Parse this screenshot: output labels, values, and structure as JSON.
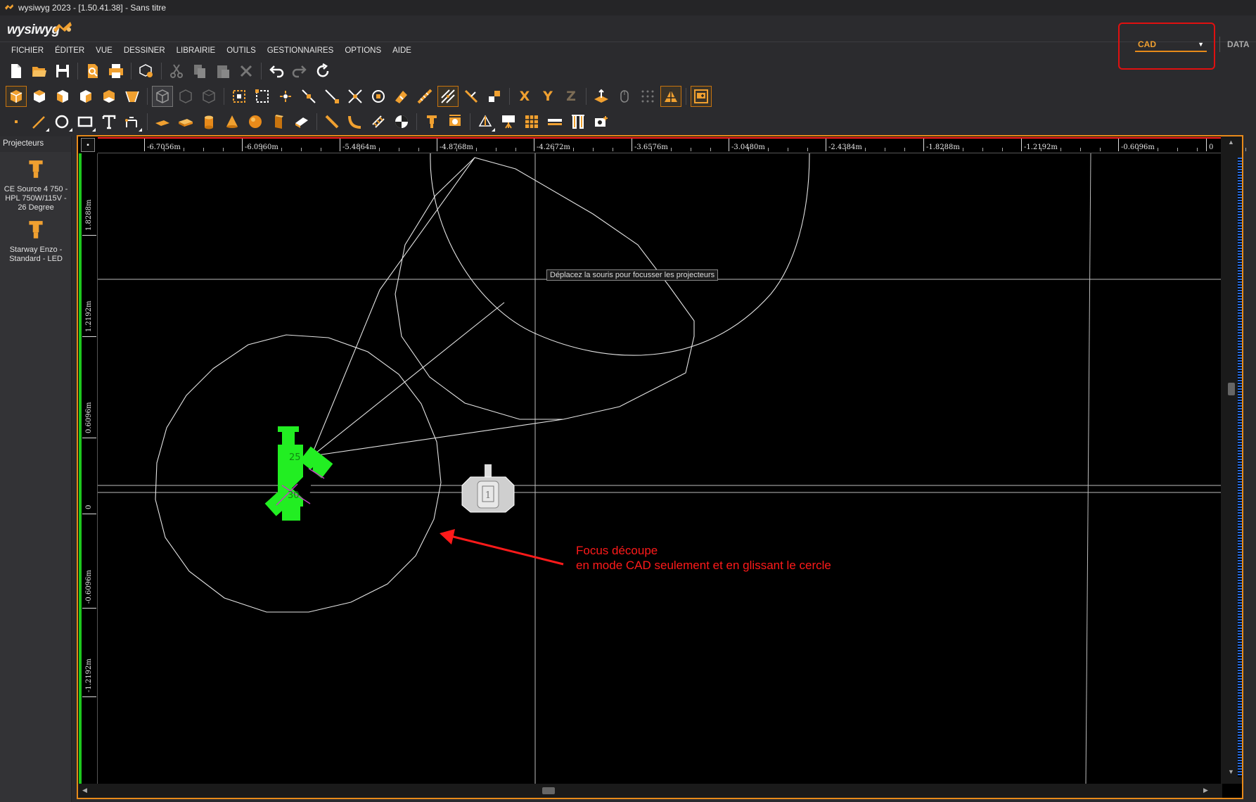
{
  "window": {
    "title": "wysiwyg 2023 - [1.50.41.38] - Sans titre"
  },
  "brand": {
    "name": "wysiwyg"
  },
  "mode": {
    "selected": "CAD",
    "other_tab": "DATA"
  },
  "menu": [
    "FICHIER",
    "ÉDITER",
    "VUE",
    "DESSINER",
    "LIBRAIRIE",
    "OUTILS",
    "GESTIONNAIRES",
    "OPTIONS",
    "AIDE"
  ],
  "sidebar": {
    "header": "Projecteurs",
    "fixtures": [
      {
        "label": "CE Source 4 750 - HPL 750W/115V - 26 Degree"
      },
      {
        "label": "Starway Enzo - Standard - LED"
      }
    ]
  },
  "toolbar3": {
    "x": "X",
    "y": "Y",
    "z": "Z"
  },
  "ruler": {
    "top_labels": [
      "-6.7056m",
      "-6.0960m",
      "-5.4864m",
      "-4.8768m",
      "-4.2672m",
      "-3.6576m",
      "-3.0480m",
      "-2.4384m",
      "-1.8288m",
      "-1.2192m",
      "-0.6096m",
      "0"
    ],
    "left_labels": [
      "1.8288m",
      "1.2192m",
      "0.6096m",
      "0",
      "-0.6096m",
      "-1.2192m"
    ]
  },
  "viewport": {
    "tooltip": "Déplacez la souris pour focusser les projecteurs",
    "fixture_number": "1",
    "fixture_channels": [
      "25",
      "30"
    ],
    "annotation_lines": [
      "Focus découpe",
      "en mode CAD seulement et en glissant le cercle"
    ]
  },
  "colors": {
    "accent": "#e88a1a",
    "annotation": "#ff1a1a",
    "fixture_green": "#22ee22"
  }
}
